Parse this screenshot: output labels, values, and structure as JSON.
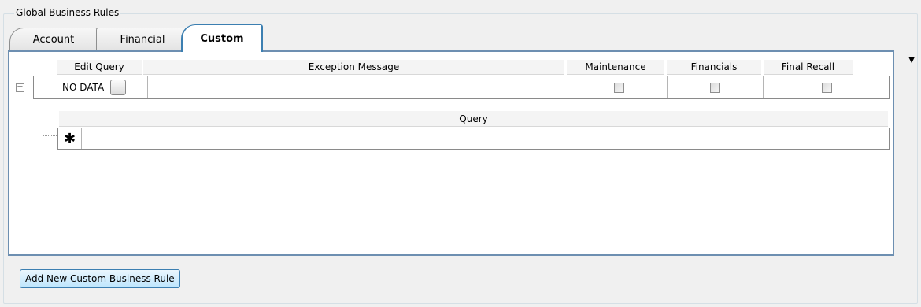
{
  "group": {
    "title": "Global Business Rules"
  },
  "tabs": [
    {
      "label": "Account"
    },
    {
      "label": "Financial"
    },
    {
      "label": "Custom"
    }
  ],
  "tab_dropdown_glyph": "▼",
  "grid": {
    "columns": [
      "Edit Query",
      "Exception Message",
      "Maintenance",
      "Financials",
      "Final Recall"
    ],
    "row": {
      "edit_query": "NO DATA",
      "expander": "−"
    },
    "sub_grid": {
      "column": "Query",
      "new_row_glyph": "✱"
    }
  },
  "buttons": {
    "add_rule": "Add New Custom Business Rule"
  }
}
